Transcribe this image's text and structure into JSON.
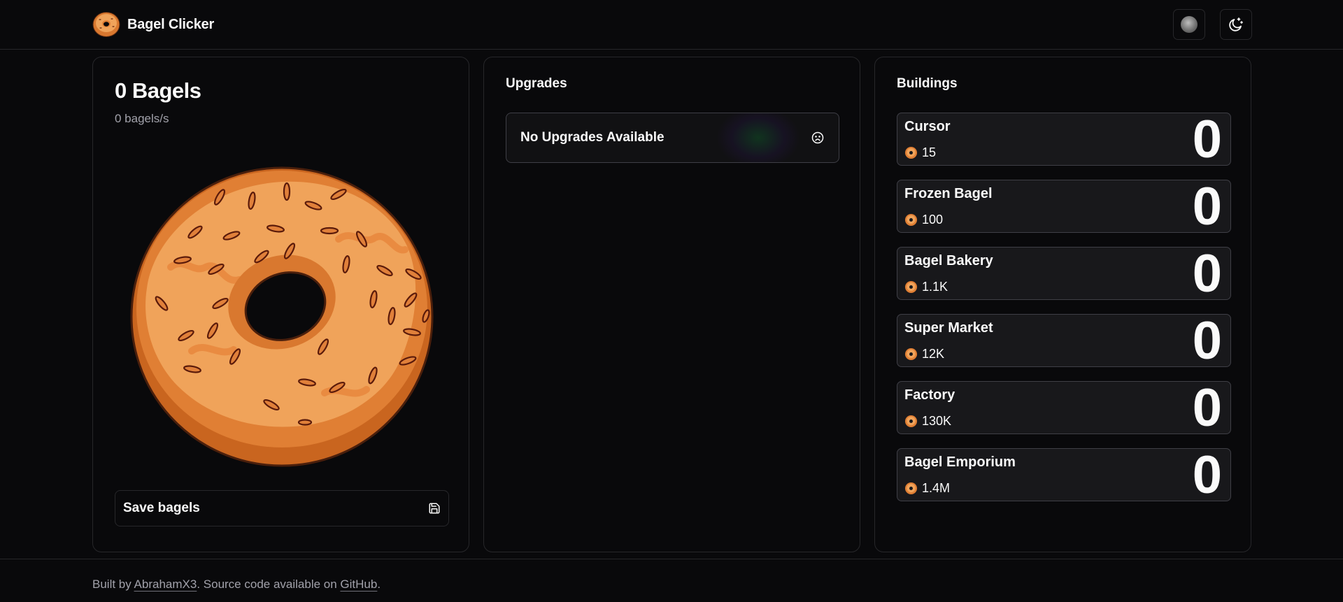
{
  "header": {
    "title": "Bagel Clicker",
    "logo_icon": "bagel-icon",
    "avatar_icon": "github-avatar-icon",
    "theme_icon": "moon-stars-icon"
  },
  "clicker": {
    "count_label": "0 Bagels",
    "rate_label": "0 bagels/s",
    "save_label": "Save bagels",
    "save_icon": "floppy-disk-icon"
  },
  "upgrades": {
    "heading": "Upgrades",
    "empty_label": "No Upgrades Available",
    "empty_icon": "sad-face-icon"
  },
  "buildings": {
    "heading": "Buildings",
    "items": [
      {
        "name": "Cursor",
        "cost": "15",
        "owned": "0"
      },
      {
        "name": "Frozen Bagel",
        "cost": "100",
        "owned": "0"
      },
      {
        "name": "Bagel Bakery",
        "cost": "1.1K",
        "owned": "0"
      },
      {
        "name": "Super Market",
        "cost": "12K",
        "owned": "0"
      },
      {
        "name": "Factory",
        "cost": "130K",
        "owned": "0"
      },
      {
        "name": "Bagel Emporium",
        "cost": "1.4M",
        "owned": "0"
      }
    ]
  },
  "footer": {
    "prefix": "Built by ",
    "author_link": "AbrahamX3",
    "middle": ". Source code available on ",
    "source_link": "GitHub",
    "suffix": "."
  },
  "colors": {
    "background": "#09090b",
    "border": "#27272a",
    "card": "#18181b",
    "bagel_orange": "#e07f34"
  }
}
